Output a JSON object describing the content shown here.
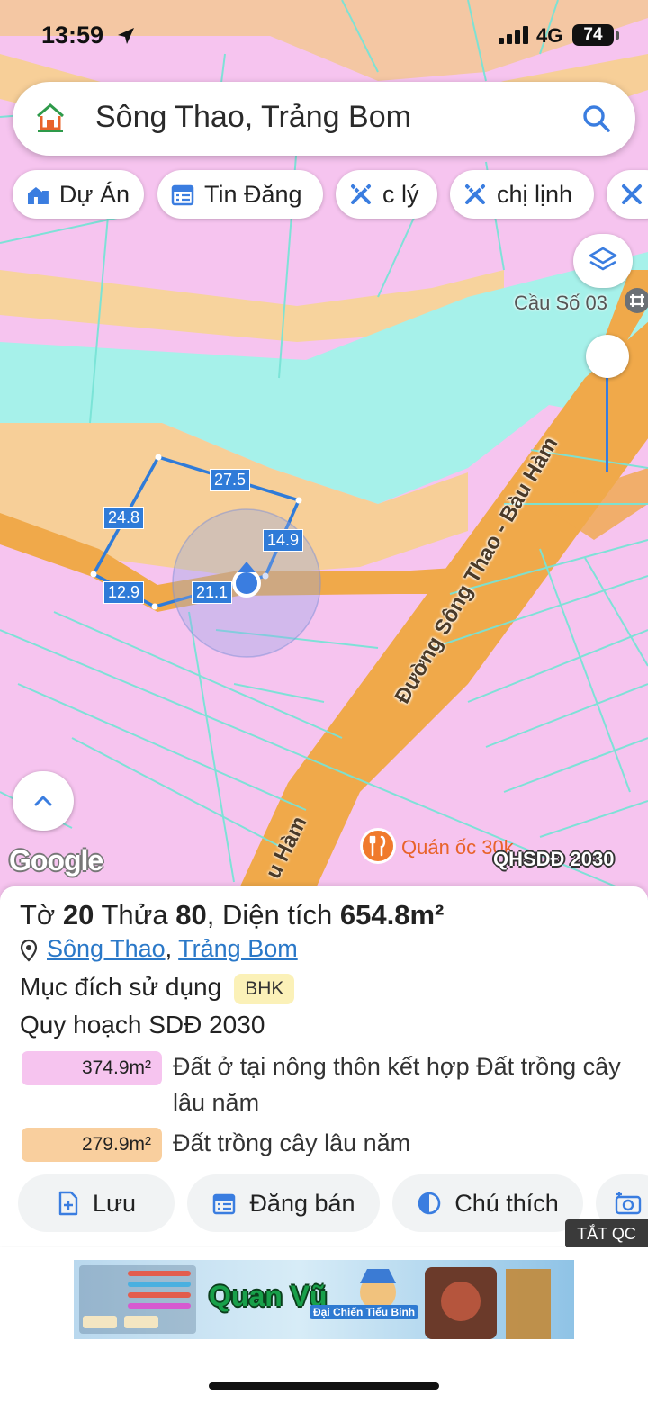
{
  "status_bar": {
    "time": "13:59",
    "network": "4G",
    "battery": "74"
  },
  "search": {
    "value": "Sông Thao, Trảng Bom"
  },
  "chips": [
    {
      "label": "Dự Án",
      "icon": "home-building-icon"
    },
    {
      "label": "Tin Đăng",
      "icon": "calendar-list-icon"
    },
    {
      "label": "c lý",
      "icon": "ruler-cross-icon"
    },
    {
      "label": "chị lịnh",
      "icon": "ruler-cross-icon"
    }
  ],
  "map": {
    "bridge_label": "Cầu Số 03",
    "road_label": "Đường Sông Thao - Bàu Hàm",
    "road_label_partial": "u Hàm",
    "poi_label": "Quán ốc 30k",
    "google_logo": "Google",
    "plan_tag": "QHSDĐ 2030",
    "edge_lengths": [
      "27.5",
      "24.8",
      "14.9",
      "12.9",
      "21.1"
    ]
  },
  "parcel": {
    "title_prefix": "Tờ",
    "sheet": "20",
    "plot_label": "Thửa",
    "plot": "80",
    "area_label": ", Diện tích",
    "area": "654.8m²",
    "location_ward": "Sông Thao",
    "location_sep": ",",
    "location_district": "Trảng Bom",
    "purpose_label": "Mục đích sử dụng",
    "purpose_code": "BHK",
    "plan_label": "Quy hoạch SDĐ 2030",
    "land_uses": [
      {
        "area": "374.9m²",
        "description": "Đất ở tại nông thôn kết hợp Đất trồng cây lâu năm",
        "color": "#f6c4ef"
      },
      {
        "area": "279.9m²",
        "description": "Đất trồng cây lâu năm",
        "color": "#f9cf9e"
      }
    ]
  },
  "actions": {
    "save": "Lưu",
    "post": "Đăng bán",
    "legend": "Chú thích"
  },
  "ad": {
    "close_label": "TẮT QC",
    "banner_title": "Quan Vũ",
    "banner_subtitle": "Đại Chiến Tiểu Binh"
  },
  "colors": {
    "residential_pink": "#f6c4ef",
    "perennial_orange": "#f9cf9e",
    "road_orange": "#f0a94a",
    "water_cyan": "#a6f1ea",
    "boundary_blue": "#2f7bd8",
    "link_blue": "#2a78c8"
  }
}
